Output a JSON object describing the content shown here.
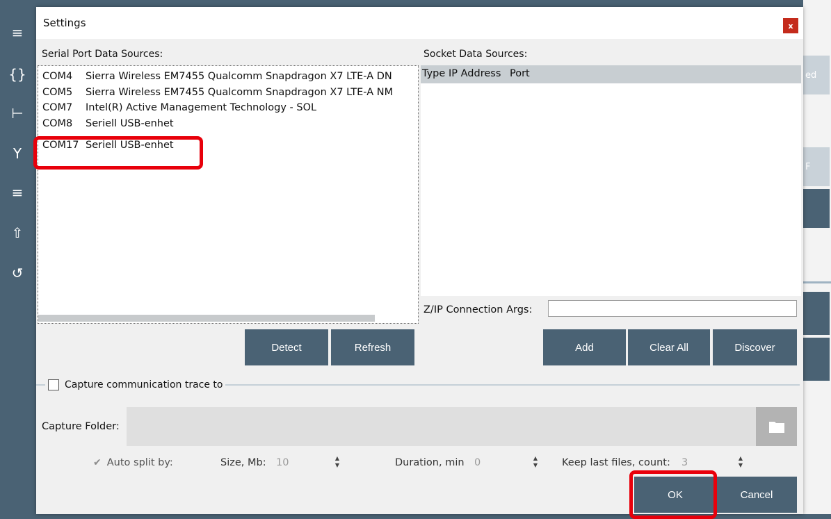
{
  "background": {
    "right_labels": [
      "ed",
      "F"
    ]
  },
  "dialog": {
    "title": "Settings",
    "close_label": "x",
    "serial_label": "Serial Port Data Sources:",
    "socket_label": "Socket Data Sources:",
    "serial_ports": [
      {
        "port": "COM4",
        "name": "Sierra Wireless EM7455 Qualcomm Snapdragon X7 LTE-A DN"
      },
      {
        "port": "COM5",
        "name": "Sierra Wireless EM7455 Qualcomm Snapdragon X7 LTE-A NM"
      },
      {
        "port": "COM7",
        "name": "Intel(R) Active Management Technology - SOL"
      },
      {
        "port": "COM8",
        "name": "Seriell USB-enhet"
      },
      {
        "port": "COM17",
        "name": "Seriell USB-enhet"
      }
    ],
    "socket_columns": [
      "Type",
      "IP Address",
      "Port"
    ],
    "zip_label": "Z/IP Connection Args:",
    "zip_value": "",
    "buttons": {
      "detect": "Detect",
      "refresh": "Refresh",
      "add": "Add",
      "clear_all": "Clear All",
      "discover": "Discover",
      "ok": "OK",
      "cancel": "Cancel"
    },
    "capture": {
      "label": "Capture communication trace to",
      "checked": false,
      "folder_label": "Capture Folder:",
      "folder_value": "",
      "auto_split_label": "Auto split by:",
      "size_label": "Size, Mb:",
      "size_value": "10",
      "duration_label": "Duration, min",
      "duration_value": "0",
      "keep_label": "Keep last files, count:",
      "keep_value": "3"
    }
  },
  "colors": {
    "accent": "#4a6274",
    "highlight": "#e8000b",
    "close": "#c42b1c"
  }
}
